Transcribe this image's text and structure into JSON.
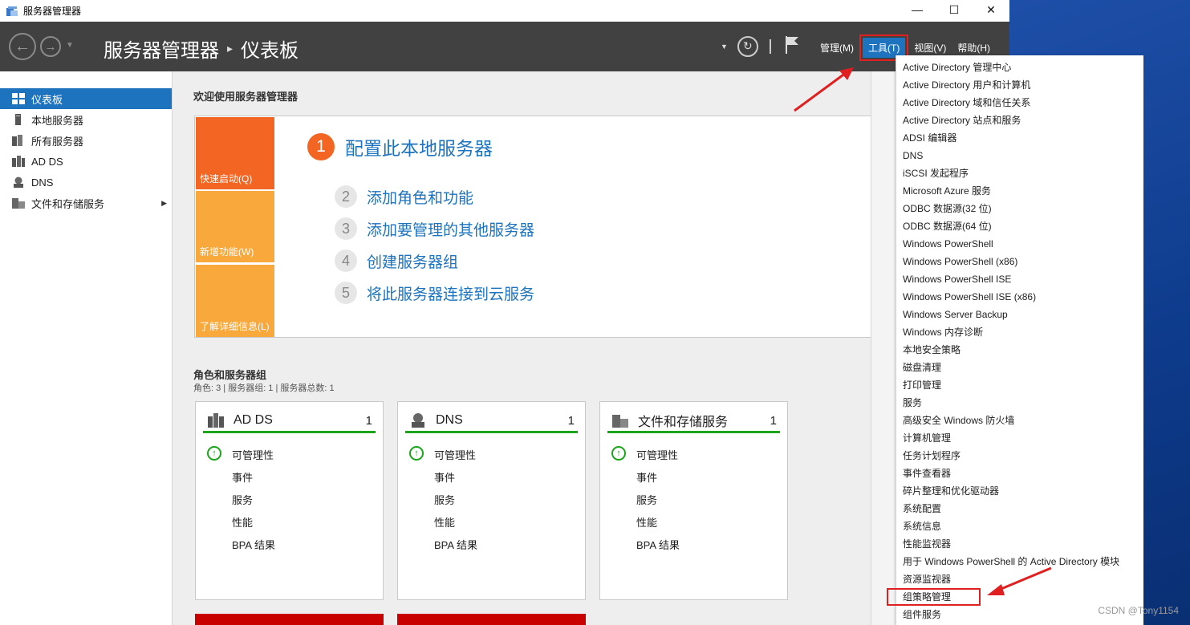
{
  "window": {
    "title": "服务器管理器"
  },
  "header": {
    "breadcrumb_root": "服务器管理器",
    "breadcrumb_sep": "▸",
    "breadcrumb_current": "仪表板",
    "menus": [
      "管理(M)",
      "工具(T)",
      "视图(V)",
      "帮助(H)"
    ]
  },
  "sidebar": {
    "items": [
      {
        "label": "仪表板",
        "icon": "dashboard-icon"
      },
      {
        "label": "本地服务器",
        "icon": "server-icon"
      },
      {
        "label": "所有服务器",
        "icon": "servers-icon"
      },
      {
        "label": "AD DS",
        "icon": "adds-icon"
      },
      {
        "label": "DNS",
        "icon": "dns-icon"
      },
      {
        "label": "文件和存储服务",
        "icon": "storage-icon"
      }
    ]
  },
  "welcome": {
    "heading": "欢迎使用服务器管理器",
    "tiles": [
      "快速启动(Q)",
      "新增功能(W)",
      "了解详细信息(L)"
    ],
    "steps": [
      {
        "num": "1",
        "label": "配置此本地服务器"
      },
      {
        "num": "2",
        "label": "添加角色和功能"
      },
      {
        "num": "3",
        "label": "添加要管理的其他服务器"
      },
      {
        "num": "4",
        "label": "创建服务器组"
      },
      {
        "num": "5",
        "label": "将此服务器连接到云服务"
      }
    ]
  },
  "roles": {
    "heading": "角色和服务器组",
    "summary": "角色: 3 | 服务器组: 1 | 服务器总数: 1",
    "cards": [
      {
        "title": "AD DS",
        "count": "1",
        "rows": [
          "可管理性",
          "事件",
          "服务",
          "性能",
          "BPA 结果"
        ]
      },
      {
        "title": "DNS",
        "count": "1",
        "rows": [
          "可管理性",
          "事件",
          "服务",
          "性能",
          "BPA 结果"
        ]
      },
      {
        "title": "文件和存储服务",
        "count": "1",
        "rows": [
          "可管理性",
          "事件",
          "服务",
          "性能",
          "BPA 结果"
        ]
      }
    ]
  },
  "tools_menu": {
    "items": [
      "Active Directory 管理中心",
      "Active Directory 用户和计算机",
      "Active Directory 域和信任关系",
      "Active Directory 站点和服务",
      "ADSI 编辑器",
      "DNS",
      "iSCSI 发起程序",
      "Microsoft Azure 服务",
      "ODBC 数据源(32 位)",
      "ODBC 数据源(64 位)",
      "Windows PowerShell",
      "Windows PowerShell (x86)",
      "Windows PowerShell ISE",
      "Windows PowerShell ISE (x86)",
      "Windows Server Backup",
      "Windows 内存诊断",
      "本地安全策略",
      "磁盘清理",
      "打印管理",
      "服务",
      "高级安全 Windows 防火墙",
      "计算机管理",
      "任务计划程序",
      "事件查看器",
      "碎片整理和优化驱动器",
      "系统配置",
      "系统信息",
      "性能监视器",
      "用于 Windows PowerShell 的 Active Directory 模块",
      "资源监视器",
      "组策略管理",
      "组件服务"
    ],
    "highlighted": "组策略管理"
  },
  "watermark": "CSDN @Tony1154",
  "colors": {
    "accent": "#1e73be",
    "orange": "#f26522",
    "amber": "#f9a83b",
    "ok": "#1aa51a",
    "annotation": "#e02020"
  }
}
